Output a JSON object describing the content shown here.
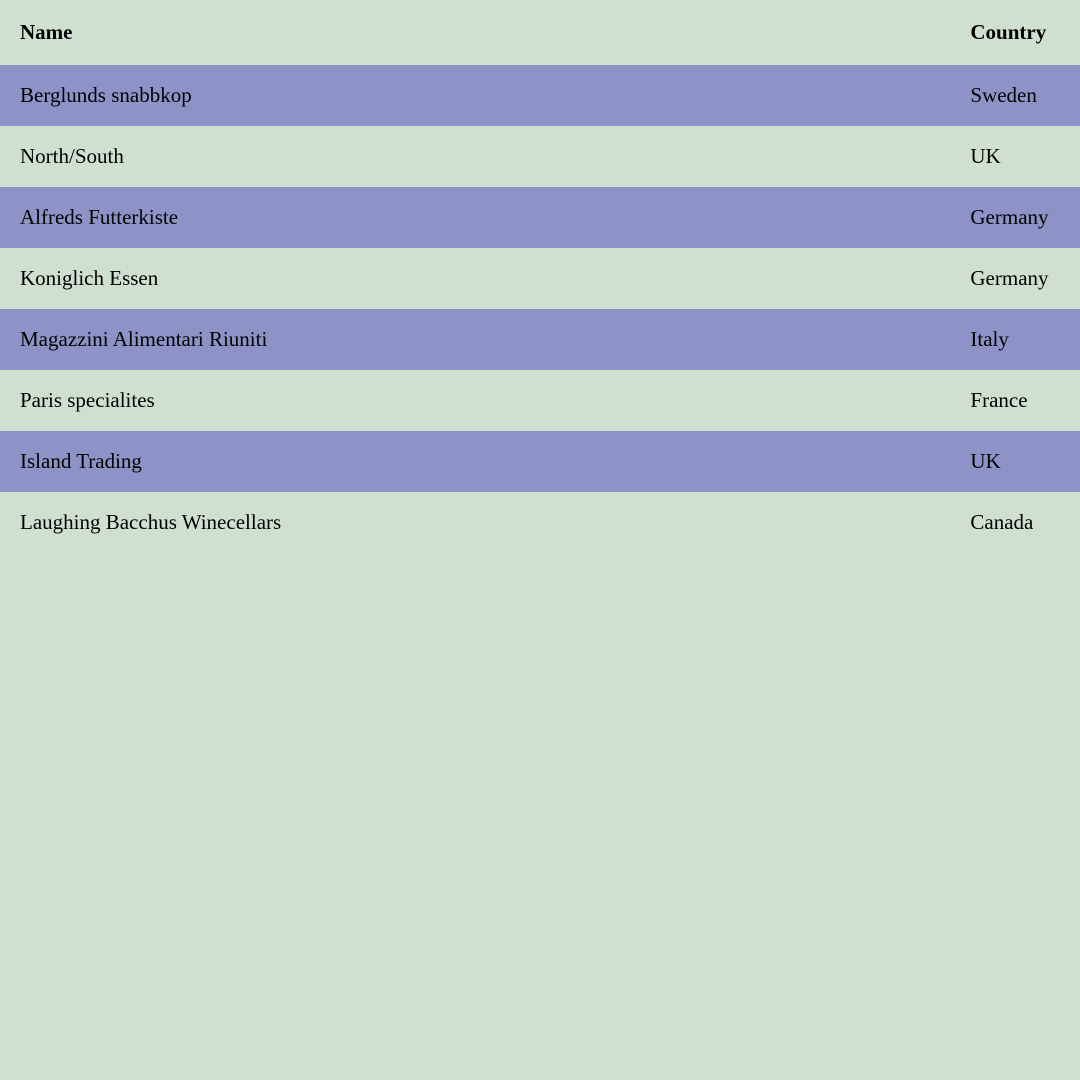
{
  "table": {
    "headers": {
      "name": "Name",
      "country": "Country"
    },
    "rows": [
      {
        "name": "Berglunds snabbkop",
        "country": "Sweden"
      },
      {
        "name": "North/South",
        "country": "UK"
      },
      {
        "name": "Alfreds Futterkiste",
        "country": "Germany"
      },
      {
        "name": "Koniglich Essen",
        "country": "Germany"
      },
      {
        "name": "Magazzini Alimentari Riuniti",
        "country": "Italy"
      },
      {
        "name": "Paris specialites",
        "country": "France"
      },
      {
        "name": "Island Trading",
        "country": "UK"
      },
      {
        "name": "Laughing Bacchus Winecellars",
        "country": "Canada"
      }
    ]
  }
}
